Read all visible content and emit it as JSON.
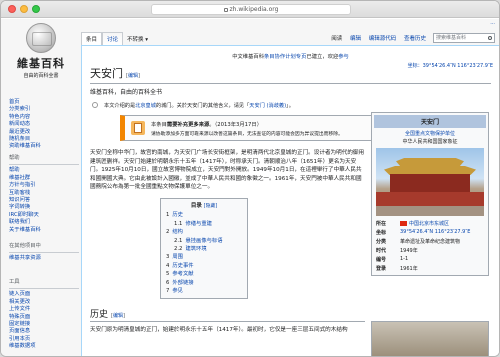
{
  "browser": {
    "url": "zh.wikipedia.org"
  },
  "logo": {
    "title": "維基百科",
    "subtitle": "自由的百科全書"
  },
  "nav": {
    "main": [
      "首页",
      "分类索引",
      "特色内容",
      "新闻动态",
      "最近更改",
      "随机条目",
      "资助维基百科"
    ],
    "help_heading": "帮助",
    "help": [
      "帮助",
      "维基社群",
      "方针与指引",
      "互助客栈",
      "知识问答",
      "字词转换",
      "IRC即时聊天",
      "联络我们",
      "关于维基百科"
    ],
    "other_heading": "在其他项目中",
    "other": [
      "维基共享资源"
    ],
    "tools_heading": "工具",
    "tools": [
      "链入页面",
      "相关更改",
      "上传文件",
      "特殊页面",
      "固定链接",
      "页面信息",
      "引用本页",
      "维基数据项"
    ]
  },
  "tabs": {
    "left": [
      "条目",
      "讨论",
      "不转换"
    ],
    "right": [
      "阅读",
      "编辑",
      "编辑源代码",
      "查看历史"
    ],
    "search_placeholder": "搜索维基百科",
    "personal": "..."
  },
  "content": {
    "sitenotice_prefix": "中文维基百科",
    "sitenotice_link": "条目协作计划专页",
    "sitenotice_suffix": "已建立，欢迎",
    "sitenotice_link2": "参与",
    "coord_top": "坐标：39°54′26.4″N 116°23′27.9″E",
    "title": "天安门",
    "edit_label": "编辑",
    "tagline": "维基百科，自由的百科全书",
    "hatnote_prefix": "本文介绍的是",
    "hatnote_link1": "北京皇城",
    "hatnote_middle": "的城门。关於天安门的其他含义，请见「",
    "hatnote_link2": "天安门 (消歧義)",
    "hatnote_suffix": "」。",
    "ambox_line1_prefix": "本条目",
    "ambox_line1_bold": "需要补充更多来源",
    "ambox_line1_date": "。（2013年3月17日）",
    "ambox_line2": "请协助添加多方面可靠来源以改善这篇条目，无法查证的内容可能会因为异议提出而移除。",
    "lead_text": "天安门全称中华门，故宫的南城，为天安门广场长安街框架，是明清两代北京皇城的正门。设计者为明代的御用建筑匠蒯祥。天安门始建於明朝永乐十五年（1417年），时称承天门。清朝顺治八年（1651年）更名为天安门。1925年10月10日，國立故宮博物院成立，天安門對外開放。1949年10月1日，在這裡舉行了中華人民共和國開國大典。它由此被設計入國徽，並成了中華人民共和國的象徵之一。1961年，天安門被中華人民共和國國務院公布為第一批全國重點文物保護單位之一。",
    "toc_title": "目录",
    "toc_hide": "[隐藏]",
    "toc": [
      {
        "num": "1",
        "label": "历史",
        "sub": false
      },
      {
        "num": "1.1",
        "label": "修缮与重建",
        "sub": true
      },
      {
        "num": "2",
        "label": "结构",
        "sub": false
      },
      {
        "num": "2.1",
        "label": "悬挂画像与标语",
        "sub": true
      },
      {
        "num": "2.2",
        "label": "建筑环境",
        "sub": true
      },
      {
        "num": "3",
        "label": "周围",
        "sub": false
      },
      {
        "num": "4",
        "label": "历史事件",
        "sub": false
      },
      {
        "num": "5",
        "label": "参考文献",
        "sub": false
      },
      {
        "num": "6",
        "label": "外部链接",
        "sub": false
      },
      {
        "num": "7",
        "label": "参见",
        "sub": false
      }
    ],
    "h2_history": "历史",
    "history_text": "天安门原为明清皇城的正门，始建於明永乐十五年（1417年）。最初时，它仅是一座三层五间式的木结构"
  },
  "infobox": {
    "title": "天安门",
    "caption1": "全国重点文物保护单位",
    "caption2": "中华人民共和国国家象征",
    "rows": [
      {
        "k": "所在",
        "v": "中国北京市东城区"
      },
      {
        "k": "坐标",
        "v": "39°54′26.4″N 116°23′27.9″E"
      },
      {
        "k": "分类",
        "v": "革命遗址及革命纪念建筑物"
      },
      {
        "k": "时代",
        "v": "1949年"
      },
      {
        "k": "编号",
        "v": "1-1"
      },
      {
        "k": "登录",
        "v": "1961年"
      }
    ]
  }
}
